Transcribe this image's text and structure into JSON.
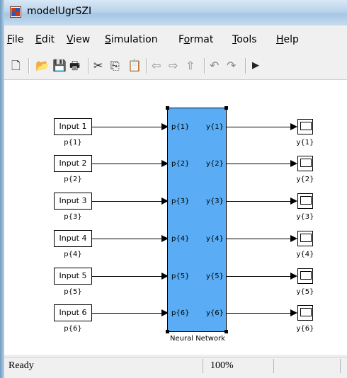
{
  "window": {
    "title": "modelUgrSZI"
  },
  "menu": [
    {
      "label": "File",
      "underline": "F",
      "rest": "ile"
    },
    {
      "label": "Edit",
      "underline": "E",
      "rest": "dit"
    },
    {
      "label": "View",
      "underline": "V",
      "rest": "iew"
    },
    {
      "label": "Simulation",
      "underline": "S",
      "rest": "imulation"
    },
    {
      "label": "Format",
      "underline": "o",
      "pre": "F",
      "rest": "rmat"
    },
    {
      "label": "Tools",
      "underline": "T",
      "rest": "ools"
    },
    {
      "label": "Help",
      "underline": "H",
      "rest": "elp"
    }
  ],
  "toolbar": {
    "icons": [
      "new-icon",
      "open-icon",
      "save-icon",
      "print-icon",
      "cut-icon",
      "copy-icon",
      "paste-icon",
      "back-icon",
      "forward-icon",
      "up-icon",
      "undo-icon",
      "redo-icon",
      "run-icon"
    ]
  },
  "diagram": {
    "inputs": [
      {
        "block": "Input 1",
        "signal": "p{1}"
      },
      {
        "block": "Input 2",
        "signal": "p{2}"
      },
      {
        "block": "Input 3",
        "signal": "p{3}"
      },
      {
        "block": "Input 4",
        "signal": "p{4}"
      },
      {
        "block": "Input 5",
        "signal": "p{5}"
      },
      {
        "block": "Input 6",
        "signal": "p{6}"
      }
    ],
    "network": {
      "name": "Neural Network",
      "in_ports": [
        "p{1}",
        "p{2}",
        "p{3}",
        "p{4}",
        "p{5}",
        "p{6}"
      ],
      "out_ports": [
        "y{1}",
        "y{2}",
        "y{3}",
        "y{4}",
        "y{5}",
        "y{6}"
      ],
      "fill": "#5aadf5"
    },
    "outputs": [
      {
        "signal": "y{1}"
      },
      {
        "signal": "y{2}"
      },
      {
        "signal": "y{3}"
      },
      {
        "signal": "y{4}"
      },
      {
        "signal": "y{5}"
      },
      {
        "signal": "y{6}"
      }
    ]
  },
  "status": {
    "text": "Ready",
    "zoom": "100%"
  }
}
